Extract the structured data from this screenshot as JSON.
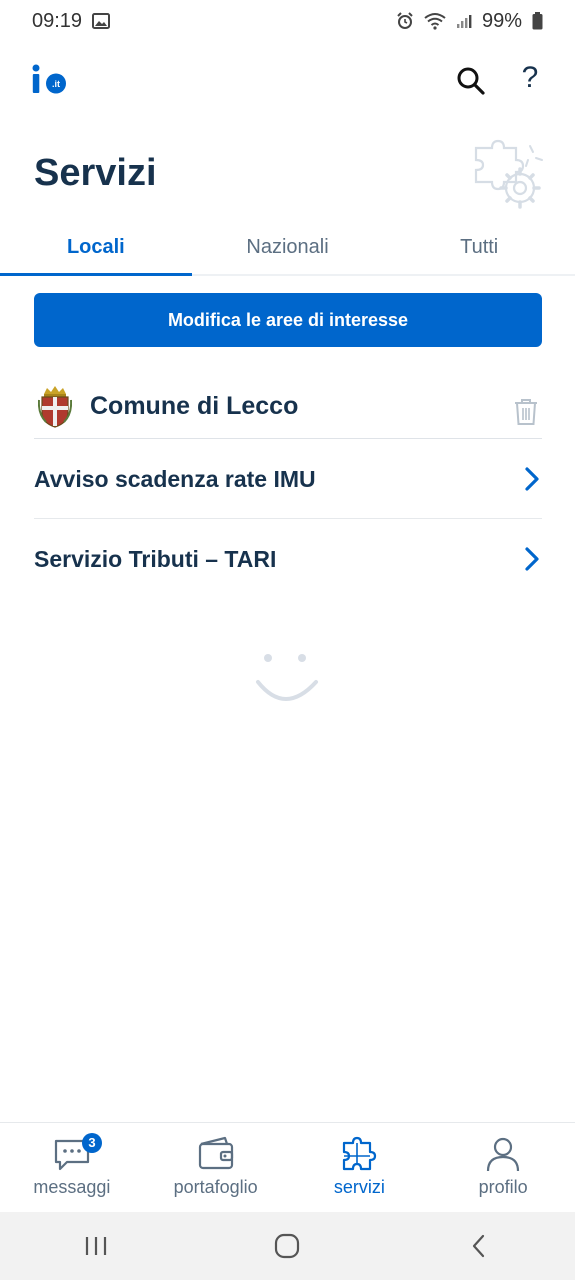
{
  "status_bar": {
    "time": "09:19",
    "battery": "99%",
    "icons": [
      "image-icon",
      "alarm-icon",
      "wifi-icon",
      "signal-icon",
      "battery-icon"
    ]
  },
  "header": {
    "logo_icon": "io-logo-icon",
    "search_icon": "search-icon",
    "help_label": "?"
  },
  "page": {
    "title": "Servizi",
    "illustration_icon": "puzzle-gear-icon"
  },
  "tabs": [
    {
      "label": "Locali",
      "active": true
    },
    {
      "label": "Nazionali",
      "active": false
    },
    {
      "label": "Tutti",
      "active": false
    }
  ],
  "primary_button": {
    "label": "Modifica le aree di interesse"
  },
  "organization": {
    "name": "Comune di Lecco",
    "logo_icon": "coat-of-arms-icon",
    "remove_icon": "trash-icon"
  },
  "services": [
    {
      "label": "Avviso scadenza rate IMU"
    },
    {
      "label": "Servizio Tributi – TARI"
    }
  ],
  "loader_icon": "smile-loading-icon",
  "bottom_nav": [
    {
      "label": "messaggi",
      "icon": "message-icon",
      "badge": "3",
      "active": false
    },
    {
      "label": "portafoglio",
      "icon": "wallet-icon",
      "active": false
    },
    {
      "label": "servizi",
      "icon": "services-puzzle-icon",
      "active": true
    },
    {
      "label": "profilo",
      "icon": "profile-icon",
      "active": false
    }
  ],
  "colors": {
    "primary": "#0066cc",
    "text": "#17324d",
    "muted": "#5c6f82"
  }
}
